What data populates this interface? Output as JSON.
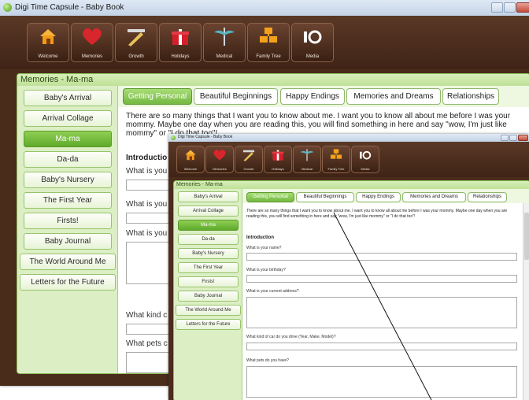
{
  "window_title": "Digi Time Capsule - Baby Book",
  "toolbar": [
    {
      "label": "Welcome",
      "icon": "house-icon"
    },
    {
      "label": "Memories",
      "icon": "heart-icon"
    },
    {
      "label": "Growth",
      "icon": "ruler-icon"
    },
    {
      "label": "Holidays",
      "icon": "gift-icon"
    },
    {
      "label": "Medical",
      "icon": "caduceus-icon"
    },
    {
      "label": "Family Tree",
      "icon": "boxes-icon"
    },
    {
      "label": "Media",
      "icon": "camera-icon"
    }
  ],
  "panel_title": "Memories - Ma-ma",
  "sidebar": [
    "Baby's Arrival",
    "Arrival Collage",
    "Ma-ma",
    "Da-da",
    "Baby's Nursery",
    "The First Year",
    "Firsts!",
    "Baby Journal",
    "The World Around Me",
    "Letters for the Future"
  ],
  "selected_sidebar": "Ma-ma",
  "tabs": [
    "Getting Personal",
    "Beautiful Beginnings",
    "Happy Endings",
    "Memories and Dreams",
    "Relationships"
  ],
  "selected_tab": "Getting Personal",
  "back": {
    "intro": "There are so many things that I want you to know about me.  I want you to know all about me before I was your mommy.  Maybe one day when you are reading this, you will find something in here and say \"wow, I'm just like mommy\" or \"I do that too\"!",
    "section": "Introductio",
    "q1": "What is you",
    "q2": "What is you",
    "q3": "What is you",
    "q4": "What kind c",
    "q5": "What pets c"
  },
  "front": {
    "intro": "There are so many things that I want you to know about me.  I want you to know all about me before I was your mommy.  Maybe one day when you are reading this, you will find something in here and say \"wow, I'm just like mommy\" or \"I do that too\"!",
    "section": "Introduction",
    "q1": "What is your name?",
    "q2": "What is your birthday?",
    "q3": "What is your current address?",
    "q4": "What kind of car do you drive (Year, Make, Model)?",
    "q5": "What pets do you have?"
  },
  "colors": {
    "frame": "#4a2c1b",
    "accent_green": "#6cb33a",
    "panel_bg": "#f4fbe8",
    "heart": "#d7262c",
    "gift": "#d71f2b",
    "house": "#f39a1b"
  }
}
